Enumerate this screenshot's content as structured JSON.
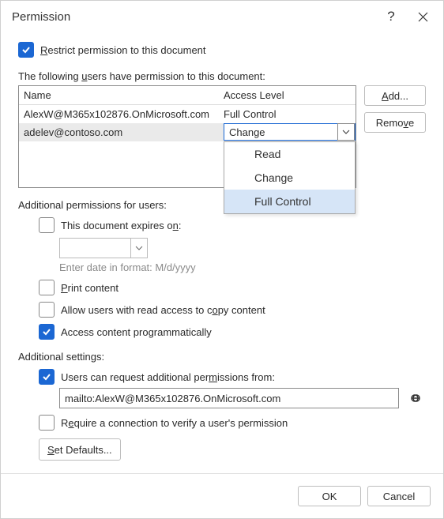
{
  "title": "Permission",
  "restrict_label_pre": "",
  "restrict_label": "estrict permission to this document",
  "restrict_u": "R",
  "restrict_checked": true,
  "users_label_pre": "The following ",
  "users_label_u": "u",
  "users_label_post": "sers have permission to this document:",
  "cols": {
    "name": "Name",
    "access": "Access Level"
  },
  "rows": [
    {
      "name": "AlexW@M365x102876.OnMicrosoft.com",
      "access": "Full Control",
      "selected": false
    },
    {
      "name": "adelev@contoso.com",
      "access": "Change",
      "selected": true
    }
  ],
  "dropdown_options": [
    "Read",
    "Change",
    "Full Control"
  ],
  "dropdown_highlight": 2,
  "side": {
    "add": "Add...",
    "add_u": "A",
    "remove": "Remove",
    "remove_u": "v"
  },
  "addl_perm_label": "Additional permissions for users:",
  "expires_pre": "This document expires o",
  "expires_u": "n",
  "expires_post": ":",
  "date_hint": "Enter date in format: M/d/yyyy",
  "print_u": "P",
  "print_post": "rint content",
  "copy_pre": "Allow users with read access to c",
  "copy_u": "o",
  "copy_post": "py content",
  "prog_pre": "Access content pro",
  "prog_u": "g",
  "prog_post": "rammatically",
  "addl_set_label": "Additional settings:",
  "req_pre": "Users can request additional per",
  "req_u": "m",
  "req_post": "issions from:",
  "mailto": "mailto:AlexW@M365x102876.OnMicrosoft.com",
  "verify_pre": "R",
  "verify_u": "e",
  "verify_post": "quire a connection to verify a user's permission",
  "defaults_u": "S",
  "defaults_post": "et Defaults...",
  "ok": "OK",
  "cancel": "Cancel"
}
